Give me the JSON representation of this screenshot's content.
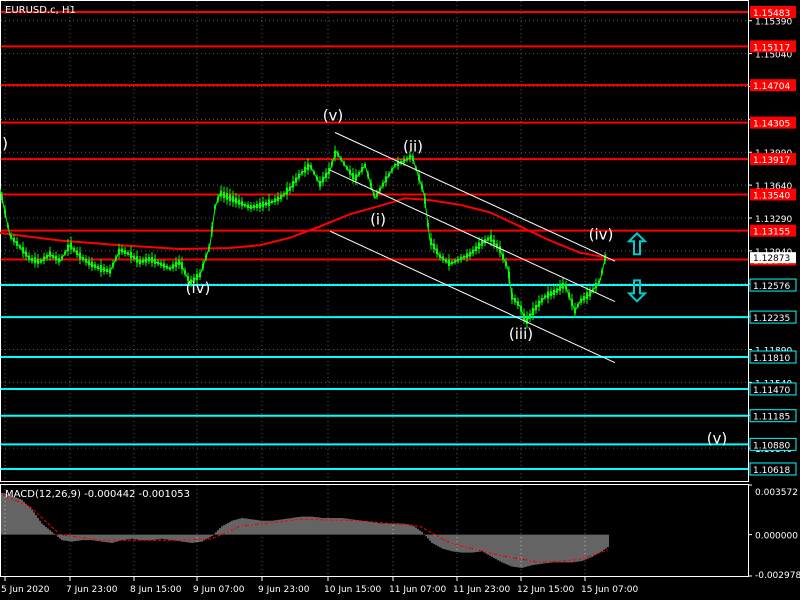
{
  "symbol_title": "EURUSD.c, H1",
  "macd_title": "MACD(12,26,9) -0.000442 -0.001053",
  "colors": {
    "background": "#000000",
    "grid": "#5a5a5a",
    "axis": "#ffffff",
    "candle": "#00ff00",
    "ma": "#ff0000",
    "resistance": "#ff0000",
    "support": "#00ffff",
    "channel": "#ffffff",
    "arrow": "#00cccc",
    "macd_hist": "#c8c8c8",
    "macd_signal": "#ff0000"
  },
  "icons": {
    "up": "up-arrow-icon",
    "down": "down-arrow-icon"
  },
  "chart_data": [
    {
      "type": "candlestick",
      "title": "EURUSD.c, H1",
      "ylim": [
        1.1049,
        1.156
      ],
      "grid": true,
      "price_axis_labels": [
        "1.15390",
        "1.15040",
        "1.14690",
        "1.14340",
        "1.13990",
        "1.13640",
        "1.13290",
        "1.12940",
        "1.12590",
        "1.12240",
        "1.11890",
        "1.11540",
        "1.11190",
        "1.10840"
      ],
      "time_axis_labels": [
        "5 Jun 2020",
        "7 Jun 23:00",
        "8 Jun 15:00",
        "9 Jun 07:00",
        "9 Jun 23:00",
        "10 Jun 15:00",
        "11 Jun 07:00",
        "11 Jun 23:00",
        "12 Jun 15:00",
        "15 Jun 07:00"
      ],
      "resistance_levels": [
        "1.15483",
        "1.15117",
        "1.14704",
        "1.14305",
        "1.13917",
        "1.13540",
        "1.13155",
        "1.12848"
      ],
      "support_levels": [
        "1.12576",
        "1.12235",
        "1.11810",
        "1.11470",
        "1.11185",
        "1.10880",
        "1.10618"
      ],
      "close_price": "1.12873",
      "close_anchor": [
        1.12848,
        1.12873
      ],
      "price_path": [
        [
          0,
          1.136
        ],
        [
          10,
          1.131
        ],
        [
          20,
          1.1298
        ],
        [
          30,
          1.1285
        ],
        [
          40,
          1.1282
        ],
        [
          50,
          1.129
        ],
        [
          60,
          1.1283
        ],
        [
          70,
          1.13
        ],
        [
          80,
          1.1288
        ],
        [
          90,
          1.128
        ],
        [
          100,
          1.1275
        ],
        [
          110,
          1.1272
        ],
        [
          120,
          1.1295
        ],
        [
          130,
          1.129
        ],
        [
          140,
          1.1282
        ],
        [
          150,
          1.1285
        ],
        [
          160,
          1.128
        ],
        [
          170,
          1.1275
        ],
        [
          180,
          1.1282
        ],
        [
          190,
          1.126
        ],
        [
          200,
          1.1268
        ],
        [
          210,
          1.13
        ],
        [
          215,
          1.134
        ],
        [
          220,
          1.1355
        ],
        [
          230,
          1.135
        ],
        [
          240,
          1.1345
        ],
        [
          250,
          1.134
        ],
        [
          260,
          1.1342
        ],
        [
          270,
          1.1345
        ],
        [
          280,
          1.135
        ],
        [
          290,
          1.136
        ],
        [
          300,
          1.1375
        ],
        [
          310,
          1.1385
        ],
        [
          320,
          1.1365
        ],
        [
          330,
          1.138
        ],
        [
          336,
          1.14
        ],
        [
          345,
          1.1385
        ],
        [
          355,
          1.137
        ],
        [
          365,
          1.1385
        ],
        [
          375,
          1.135
        ],
        [
          385,
          1.1368
        ],
        [
          395,
          1.1385
        ],
        [
          405,
          1.139
        ],
        [
          412,
          1.1395
        ],
        [
          418,
          1.1375
        ],
        [
          424,
          1.1355
        ],
        [
          430,
          1.1305
        ],
        [
          440,
          1.1288
        ],
        [
          450,
          1.128
        ],
        [
          460,
          1.1285
        ],
        [
          470,
          1.129
        ],
        [
          480,
          1.13
        ],
        [
          490,
          1.1308
        ],
        [
          500,
          1.1295
        ],
        [
          508,
          1.1275
        ],
        [
          512,
          1.1245
        ],
        [
          520,
          1.1235
        ],
        [
          526,
          1.1218
        ],
        [
          535,
          1.1232
        ],
        [
          545,
          1.1245
        ],
        [
          555,
          1.125
        ],
        [
          565,
          1.1258
        ],
        [
          575,
          1.123
        ],
        [
          580,
          1.124
        ],
        [
          590,
          1.1248
        ],
        [
          600,
          1.1262
        ],
        [
          606,
          1.129
        ]
      ],
      "moving_average": [
        [
          0,
          1.1313
        ],
        [
          60,
          1.1305
        ],
        [
          120,
          1.13
        ],
        [
          180,
          1.1296
        ],
        [
          230,
          1.1297
        ],
        [
          260,
          1.13
        ],
        [
          290,
          1.1308
        ],
        [
          320,
          1.132
        ],
        [
          350,
          1.1333
        ],
        [
          380,
          1.1342
        ],
        [
          405,
          1.135
        ],
        [
          430,
          1.1348
        ],
        [
          460,
          1.1343
        ],
        [
          490,
          1.1335
        ],
        [
          520,
          1.132
        ],
        [
          550,
          1.1305
        ],
        [
          580,
          1.1292
        ],
        [
          606,
          1.1287
        ]
      ],
      "channel_lines": [
        {
          "from": [
            335,
            1.142
          ],
          "to": [
            615,
            1.1283
          ]
        },
        {
          "from": [
            330,
            1.138
          ],
          "to": [
            615,
            1.124
          ]
        },
        {
          "from": [
            330,
            1.1315
          ],
          "to": [
            615,
            1.1175
          ]
        }
      ],
      "wave_labels": [
        {
          "text": "(v)",
          "at": [
            333,
            1.1433
          ]
        },
        {
          "text": "(ii)",
          "at": [
            413,
            1.14
          ]
        },
        {
          "text": "(i)",
          "at": [
            378,
            1.1322
          ]
        },
        {
          "text": "(iv)",
          "at": [
            198,
            1.1249
          ]
        },
        {
          "text": "(iii)",
          "at": [
            521,
            1.12
          ]
        },
        {
          "text": "(iv)",
          "at": [
            601,
            1.1306
          ]
        },
        {
          "text": "(v)",
          "at": [
            717,
            1.1089
          ]
        },
        {
          "text": ")",
          "at": [
            5,
            1.1403
          ]
        }
      ],
      "arrows": [
        {
          "direction": "up",
          "at": [
            637,
            1.1301
          ]
        },
        {
          "direction": "down",
          "at": [
            637,
            1.1252
          ]
        }
      ]
    },
    {
      "type": "histogram",
      "title": "MACD(12,26,9) -0.000442 -0.001053",
      "ylim": [
        -0.002978,
        0.003572
      ],
      "axis_labels": [
        "0.003572",
        "0.000000",
        "-0.002978"
      ],
      "histogram": [
        [
          2,
          0.003
        ],
        [
          12,
          0.0028
        ],
        [
          22,
          0.0025
        ],
        [
          32,
          0.0018
        ],
        [
          42,
          0.0008
        ],
        [
          52,
          0.0002
        ],
        [
          62,
          -0.0004
        ],
        [
          72,
          -0.0005
        ],
        [
          82,
          -0.0004
        ],
        [
          92,
          -0.0004
        ],
        [
          102,
          -0.0005
        ],
        [
          112,
          -0.0006
        ],
        [
          122,
          -0.0004
        ],
        [
          132,
          -0.0003
        ],
        [
          142,
          -0.0004
        ],
        [
          152,
          -0.0004
        ],
        [
          162,
          -0.0003
        ],
        [
          172,
          -0.0004
        ],
        [
          182,
          -0.0005
        ],
        [
          192,
          -0.0006
        ],
        [
          202,
          -0.0005
        ],
        [
          212,
          -0.0001
        ],
        [
          222,
          0.0006
        ],
        [
          232,
          0.001
        ],
        [
          242,
          0.0012
        ],
        [
          252,
          0.0011
        ],
        [
          262,
          0.001
        ],
        [
          272,
          0.001
        ],
        [
          282,
          0.0011
        ],
        [
          292,
          0.0012
        ],
        [
          302,
          0.0013
        ],
        [
          312,
          0.0013
        ],
        [
          322,
          0.0012
        ],
        [
          332,
          0.0012
        ],
        [
          342,
          0.0012
        ],
        [
          352,
          0.0011
        ],
        [
          362,
          0.001
        ],
        [
          372,
          0.0009
        ],
        [
          382,
          0.0008
        ],
        [
          392,
          0.0008
        ],
        [
          402,
          0.0008
        ],
        [
          412,
          0.0007
        ],
        [
          422,
          0.0002
        ],
        [
          432,
          -0.0006
        ],
        [
          442,
          -0.001
        ],
        [
          452,
          -0.0012
        ],
        [
          462,
          -0.0013
        ],
        [
          472,
          -0.0013
        ],
        [
          482,
          -0.0012
        ],
        [
          492,
          -0.0016
        ],
        [
          502,
          -0.002
        ],
        [
          512,
          -0.0023
        ],
        [
          522,
          -0.0024
        ],
        [
          532,
          -0.0022
        ],
        [
          542,
          -0.0021
        ],
        [
          552,
          -0.002
        ],
        [
          562,
          -0.002
        ],
        [
          572,
          -0.002
        ],
        [
          582,
          -0.0019
        ],
        [
          592,
          -0.0016
        ],
        [
          602,
          -0.0012
        ],
        [
          608,
          -0.0009
        ]
      ],
      "signal": [
        [
          2,
          0.0029
        ],
        [
          30,
          0.002
        ],
        [
          60,
          0.0
        ],
        [
          100,
          -0.0004
        ],
        [
          180,
          -0.0004
        ],
        [
          212,
          -0.0003
        ],
        [
          240,
          0.0006
        ],
        [
          300,
          0.0011
        ],
        [
          360,
          0.001
        ],
        [
          420,
          0.0006
        ],
        [
          450,
          -0.0006
        ],
        [
          500,
          -0.0015
        ],
        [
          540,
          -0.002
        ],
        [
          580,
          -0.0018
        ],
        [
          608,
          -0.0011
        ]
      ]
    }
  ]
}
